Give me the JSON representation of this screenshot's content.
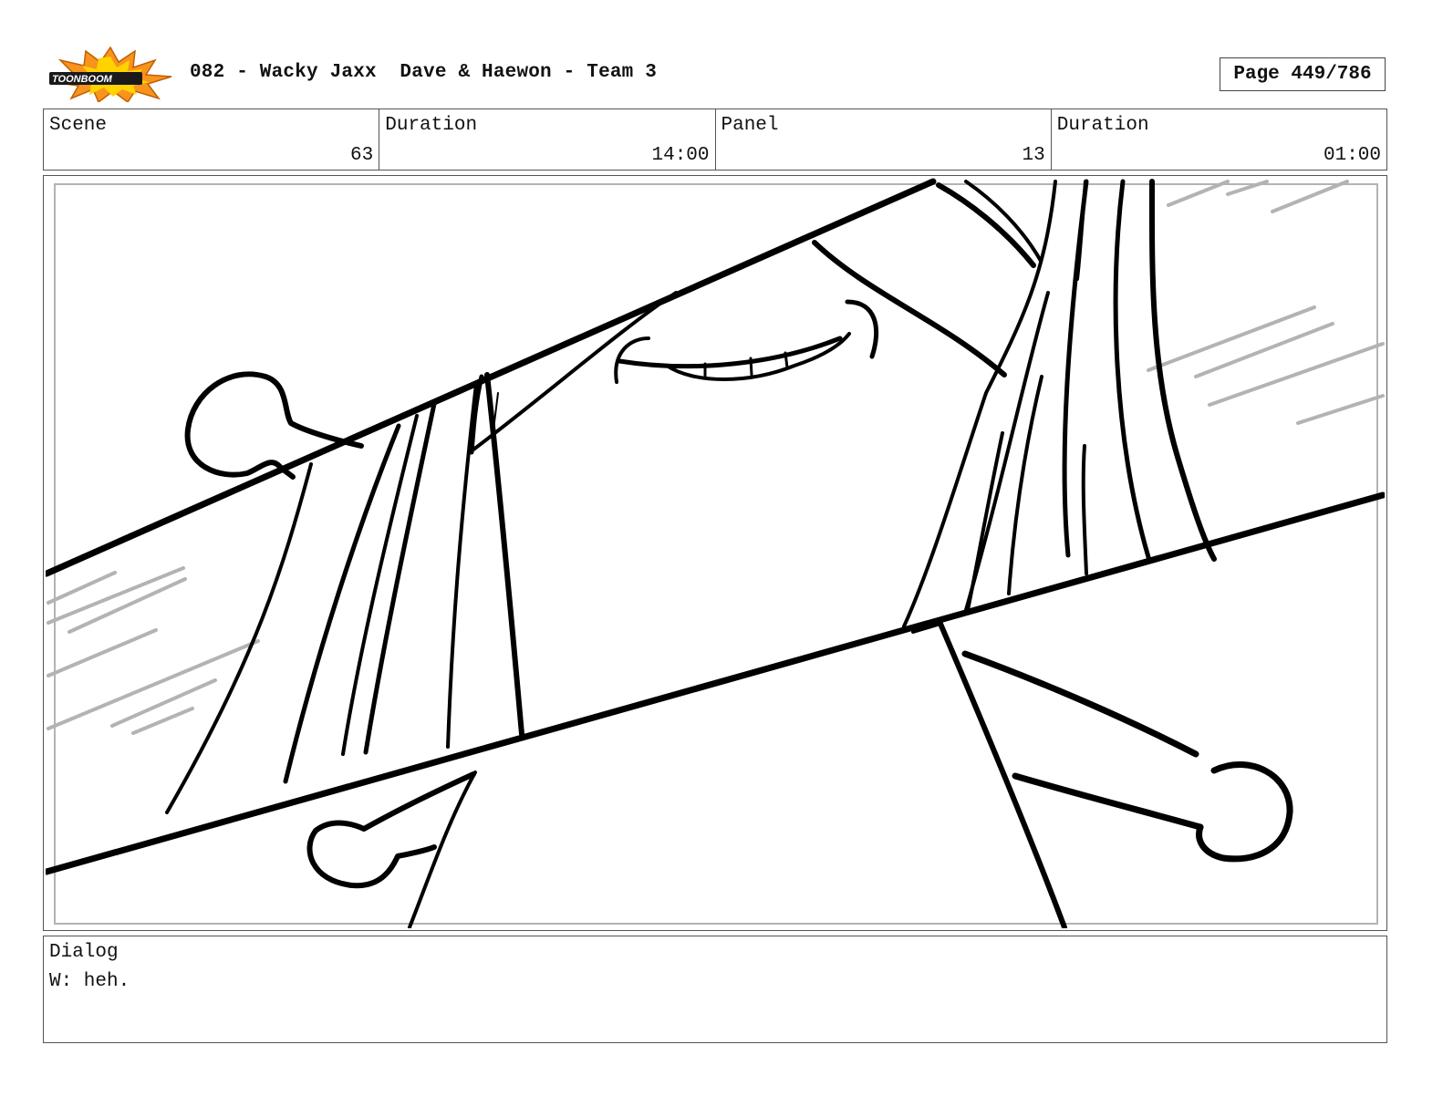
{
  "header": {
    "logo_text": "TOONBOOM",
    "title": "082 - Wacky Jaxx  Dave & Haewon - Team 3",
    "page": "Page 449/786"
  },
  "info": {
    "scene_label": "Scene",
    "scene_value": "63",
    "scene_duration_label": "Duration",
    "scene_duration_value": "14:00",
    "panel_label": "Panel",
    "panel_value": "13",
    "panel_duration_label": "Duration",
    "panel_duration_value": "01:00"
  },
  "dialog": {
    "label": "Dialog",
    "text": "W: heh."
  },
  "colors": {
    "border": "#555555",
    "ink": "#000000",
    "shade": "#b3b3b3",
    "logo_orange": "#f7941d",
    "logo_yellow": "#ffd200"
  }
}
